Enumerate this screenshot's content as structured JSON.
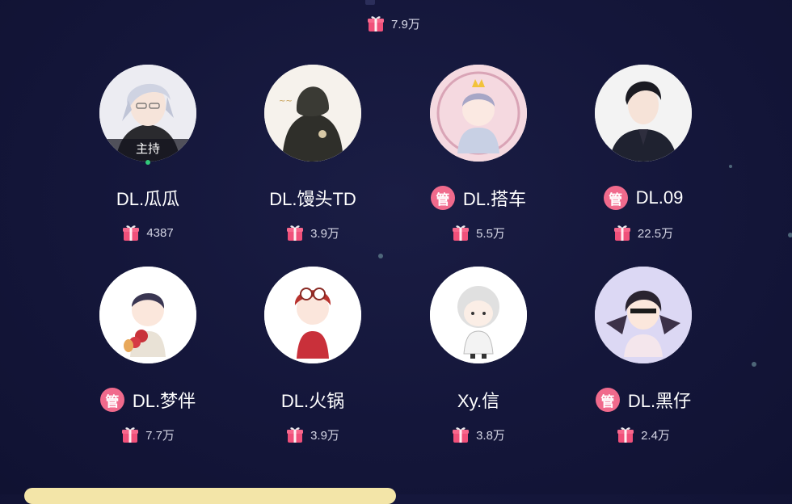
{
  "top": {
    "gift_value": "7.9万"
  },
  "seats": [
    {
      "name": "DL.瓜瓜",
      "gift": "4387",
      "admin": false,
      "host": true,
      "host_label": "主持",
      "avatar_bg": "#e8e8ee"
    },
    {
      "name": "DL.馒头TD",
      "gift": "3.9万",
      "admin": false,
      "host": false,
      "avatar_bg": "#f4f0ea"
    },
    {
      "name": "DL.搭车",
      "gift": "5.5万",
      "admin": true,
      "admin_label": "管",
      "host": false,
      "avatar_bg": "#f3d6dd"
    },
    {
      "name": "DL.09",
      "gift": "22.5万",
      "admin": true,
      "admin_label": "管",
      "host": false,
      "avatar_bg": "#f2f2f2"
    },
    {
      "name": "DL.梦伴",
      "gift": "7.7万",
      "admin": true,
      "admin_label": "管",
      "host": false,
      "avatar_bg": "#ffffff"
    },
    {
      "name": "DL.火锅",
      "gift": "3.9万",
      "admin": false,
      "host": false,
      "avatar_bg": "#ffffff"
    },
    {
      "name": "Xy.信",
      "gift": "3.8万",
      "admin": false,
      "host": false,
      "avatar_bg": "#ffffff"
    },
    {
      "name": "DL.黑仔",
      "gift": "2.4万",
      "admin": true,
      "admin_label": "管",
      "host": false,
      "avatar_bg": "#d9d6f2"
    }
  ],
  "colors": {
    "gift_icon": "#f0507a",
    "admin_badge": "#f06a8c",
    "bottom_bar": "#f3e5a8"
  },
  "icons": {
    "gift": "gift-box-icon"
  }
}
